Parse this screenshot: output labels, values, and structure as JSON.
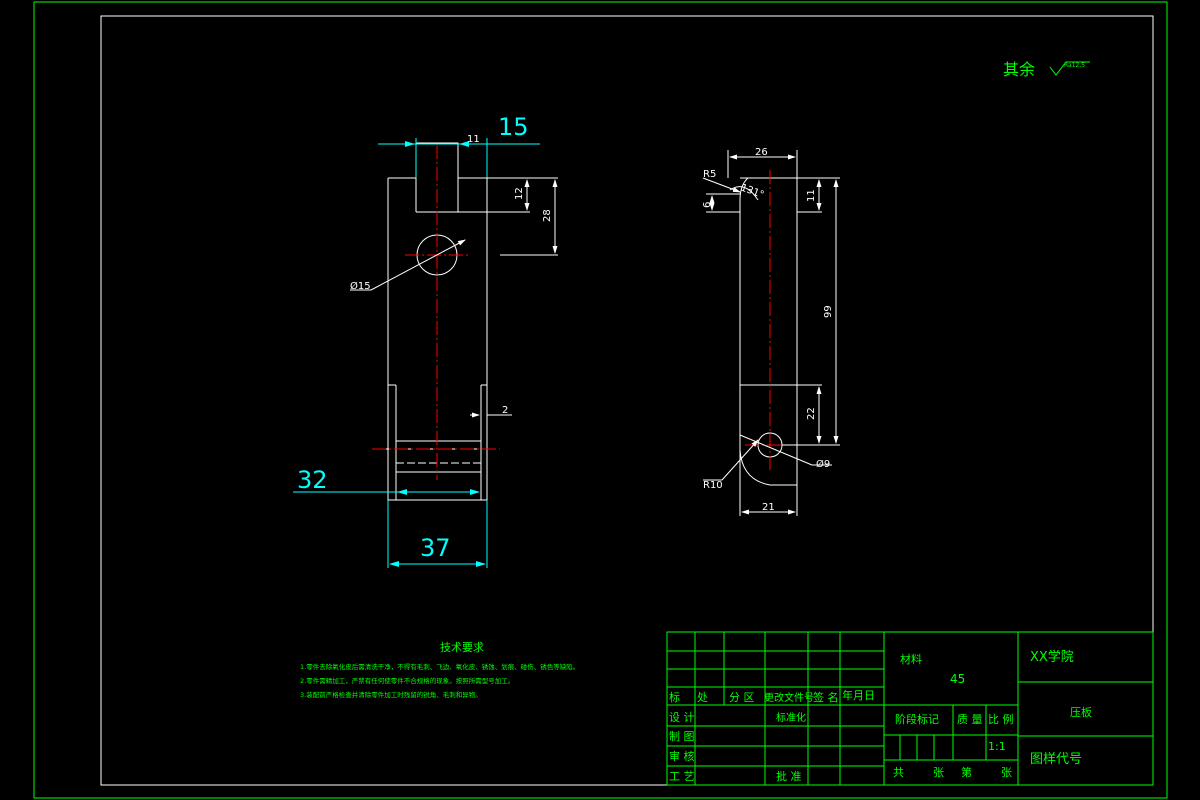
{
  "surface_finish": {
    "label": "其余",
    "symbol_value": "Ra12.5"
  },
  "left_view": {
    "dims": {
      "top_width": "15",
      "slot_width": "11",
      "slot_depth": "12",
      "hole_center": "28",
      "hole_dia": "Ø15",
      "bottom_step": "2",
      "inner_width": "32",
      "overall_width": "37"
    }
  },
  "right_view": {
    "dims": {
      "top_width": "26",
      "r_top": "R5",
      "angle": "131°",
      "dim_6": "6",
      "dim_11": "11",
      "length": "99",
      "lower": "22",
      "r_bottom": "R10",
      "hole_dia": "Ø9",
      "bottom_width": "21"
    }
  },
  "tech_requirements": {
    "title": "技术要求",
    "items": [
      "1.零件去除氧化皮后需清洗干净，不得有毛刺、飞边、氧化皮、锈蚀、划痕、碰伤、锈色等缺陷。",
      "2.零件需精加工，严禁有任何使零件不合规格的现象。按照所需型号加工。",
      "3.装配前严格检查并清除零件加工时残留的锐角、毛刺和异物。"
    ]
  },
  "title_block": {
    "rev_headers": [
      "标",
      "处",
      "分 区",
      "更改文件号",
      "签 名",
      "年月日"
    ],
    "row_labels": [
      "设 计",
      "制 图",
      "审 核",
      "工 艺"
    ],
    "standardize": "标准化",
    "approve": "批 准",
    "material_label": "材料",
    "material_value": "45",
    "stage_label": "阶段标记",
    "weight_label": "质 量",
    "scale_label": "比 例",
    "scale_value": "1:1",
    "sheet_text": [
      "共",
      "张",
      "第",
      "张"
    ],
    "school": "XX学院",
    "part_name": "压板",
    "drawing_no_label": "图样代号"
  }
}
